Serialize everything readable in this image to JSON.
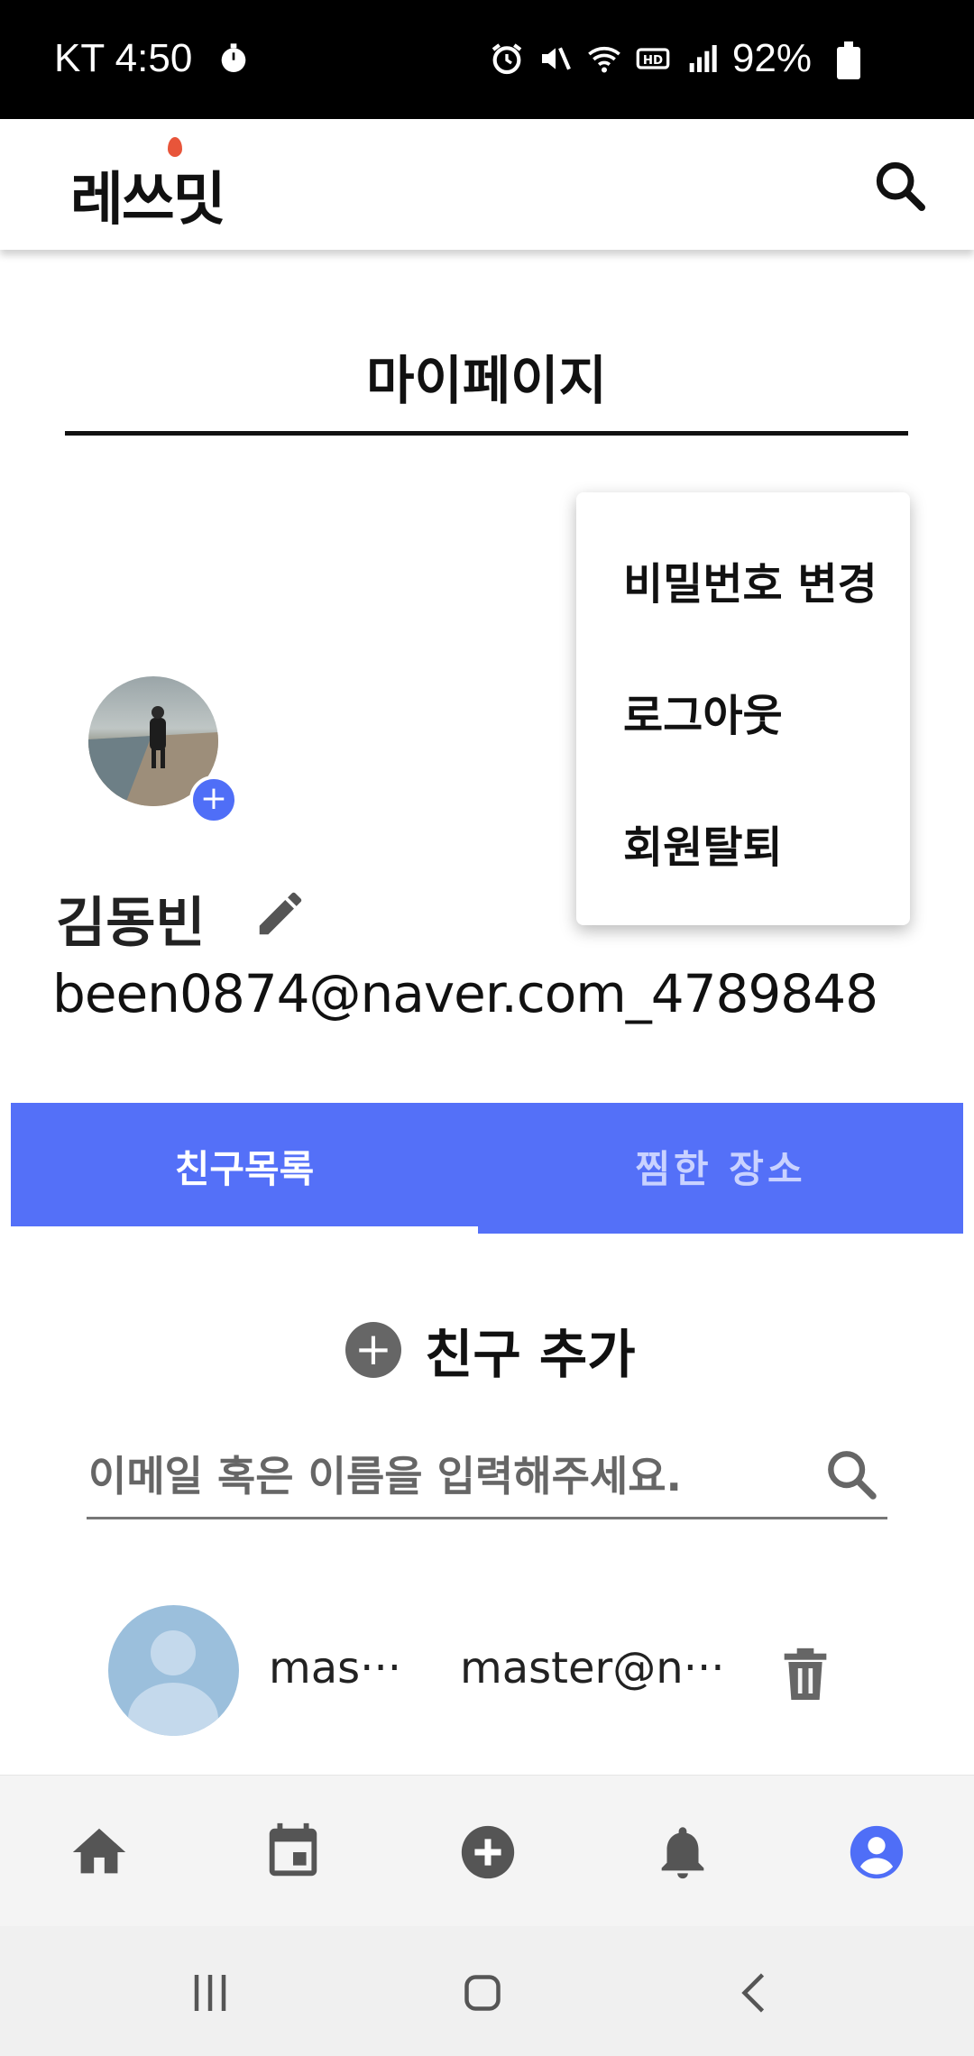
{
  "status_bar": {
    "carrier_time": "KT 4:50",
    "battery": "92%"
  },
  "app": {
    "logo_text": "레쓰밋"
  },
  "page": {
    "title": "마이페이지"
  },
  "menu": {
    "items": [
      {
        "label": "비밀번호 변경"
      },
      {
        "label": "로그아웃"
      },
      {
        "label": "회원탈퇴"
      }
    ]
  },
  "profile": {
    "name": "김동빈",
    "email": "been0874@naver.com_4789848",
    "avatar_add": "+"
  },
  "tabs": [
    {
      "label": "친구목록",
      "active": true
    },
    {
      "label": "찜한 장소",
      "active": false
    }
  ],
  "friends": {
    "add_label": "친구 추가",
    "add_symbol": "+",
    "search_placeholder": "이메일 혹은 이름을 입력해주세요.",
    "list": [
      {
        "name": "mas···",
        "email": "master@n···"
      }
    ]
  },
  "bottom_nav": {
    "items": [
      "home-icon",
      "calendar-icon",
      "add-circle-icon",
      "bell-icon",
      "account-icon"
    ],
    "active": "account-icon",
    "accent": "#4f6ef7",
    "inactive": "#555555"
  },
  "colors": {
    "primary": "#5470f8",
    "tab_inactive_text": "#c9d2ff"
  }
}
